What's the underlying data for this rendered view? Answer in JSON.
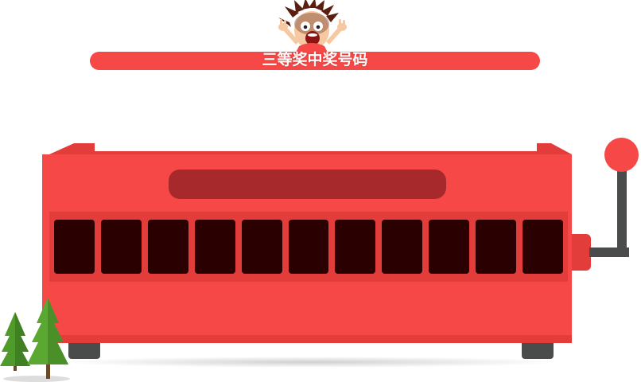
{
  "banner": {
    "title": "三等奖中奖号码"
  },
  "mascot": {
    "icon": "screaming-face-icon"
  },
  "machine": {
    "display_text": "",
    "reels": [
      "",
      "",
      "",
      "",
      "",
      "",
      "",
      "",
      "",
      "",
      ""
    ],
    "lever_icon": "lever-knob-icon"
  },
  "decor": {
    "trees_icon": "pine-trees-icon"
  },
  "colors": {
    "body": "#f64846",
    "display": "#a7292b",
    "reel": "#2b0000",
    "metal": "#4a4c4c",
    "tree": "#4f9a2a"
  }
}
